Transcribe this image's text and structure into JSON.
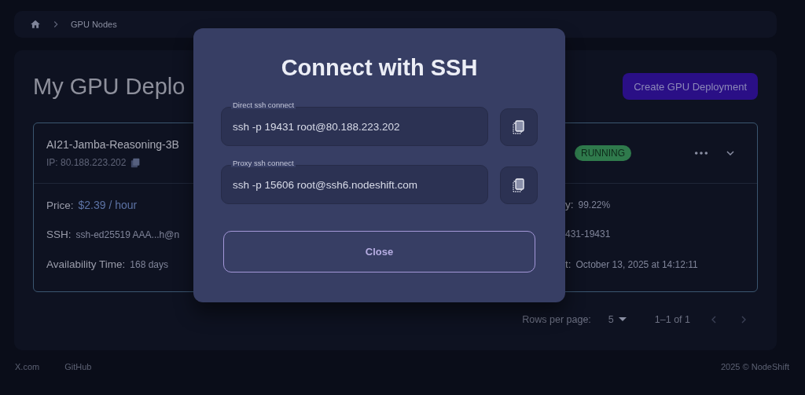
{
  "breadcrumb": {
    "current": "GPU Nodes"
  },
  "page": {
    "title": "My GPU Deplo",
    "create_button": "Create GPU Deployment"
  },
  "deployment": {
    "name": "AI21-Jamba-Reasoning-3B",
    "ip": "IP: 80.188.223.202",
    "status": "RUNNING",
    "left_rows": [
      {
        "label": "Price:",
        "value": "$2.39 / hour",
        "kind": "price"
      },
      {
        "label": "SSH:",
        "value": "ssh-ed25519 AAA...h@n",
        "kind": "plain"
      },
      {
        "label": "Availability Time:",
        "value": "168 days",
        "kind": "plain"
      }
    ],
    "right_rows": [
      {
        "label": "y:",
        "value": "99.22%"
      },
      {
        "label": "",
        "value": "431-19431"
      },
      {
        "label": "t:",
        "value": "October 13, 2025 at 14:12:11"
      }
    ]
  },
  "pagination": {
    "rows_label": "Rows per page:",
    "rows_value": "5",
    "range": "1–1 of 1"
  },
  "footer": {
    "links": [
      "X.com",
      "GitHub"
    ],
    "copyright": "2025 © NodeShift"
  },
  "dialog": {
    "title": "Connect with SSH",
    "fields": [
      {
        "label": "Direct ssh connect",
        "value": "ssh -p 19431 root@80.188.223.202"
      },
      {
        "label": "Proxy ssh connect",
        "value": "ssh -p 15606 root@ssh6.nodeshift.com"
      }
    ],
    "close_button": "Close"
  }
}
